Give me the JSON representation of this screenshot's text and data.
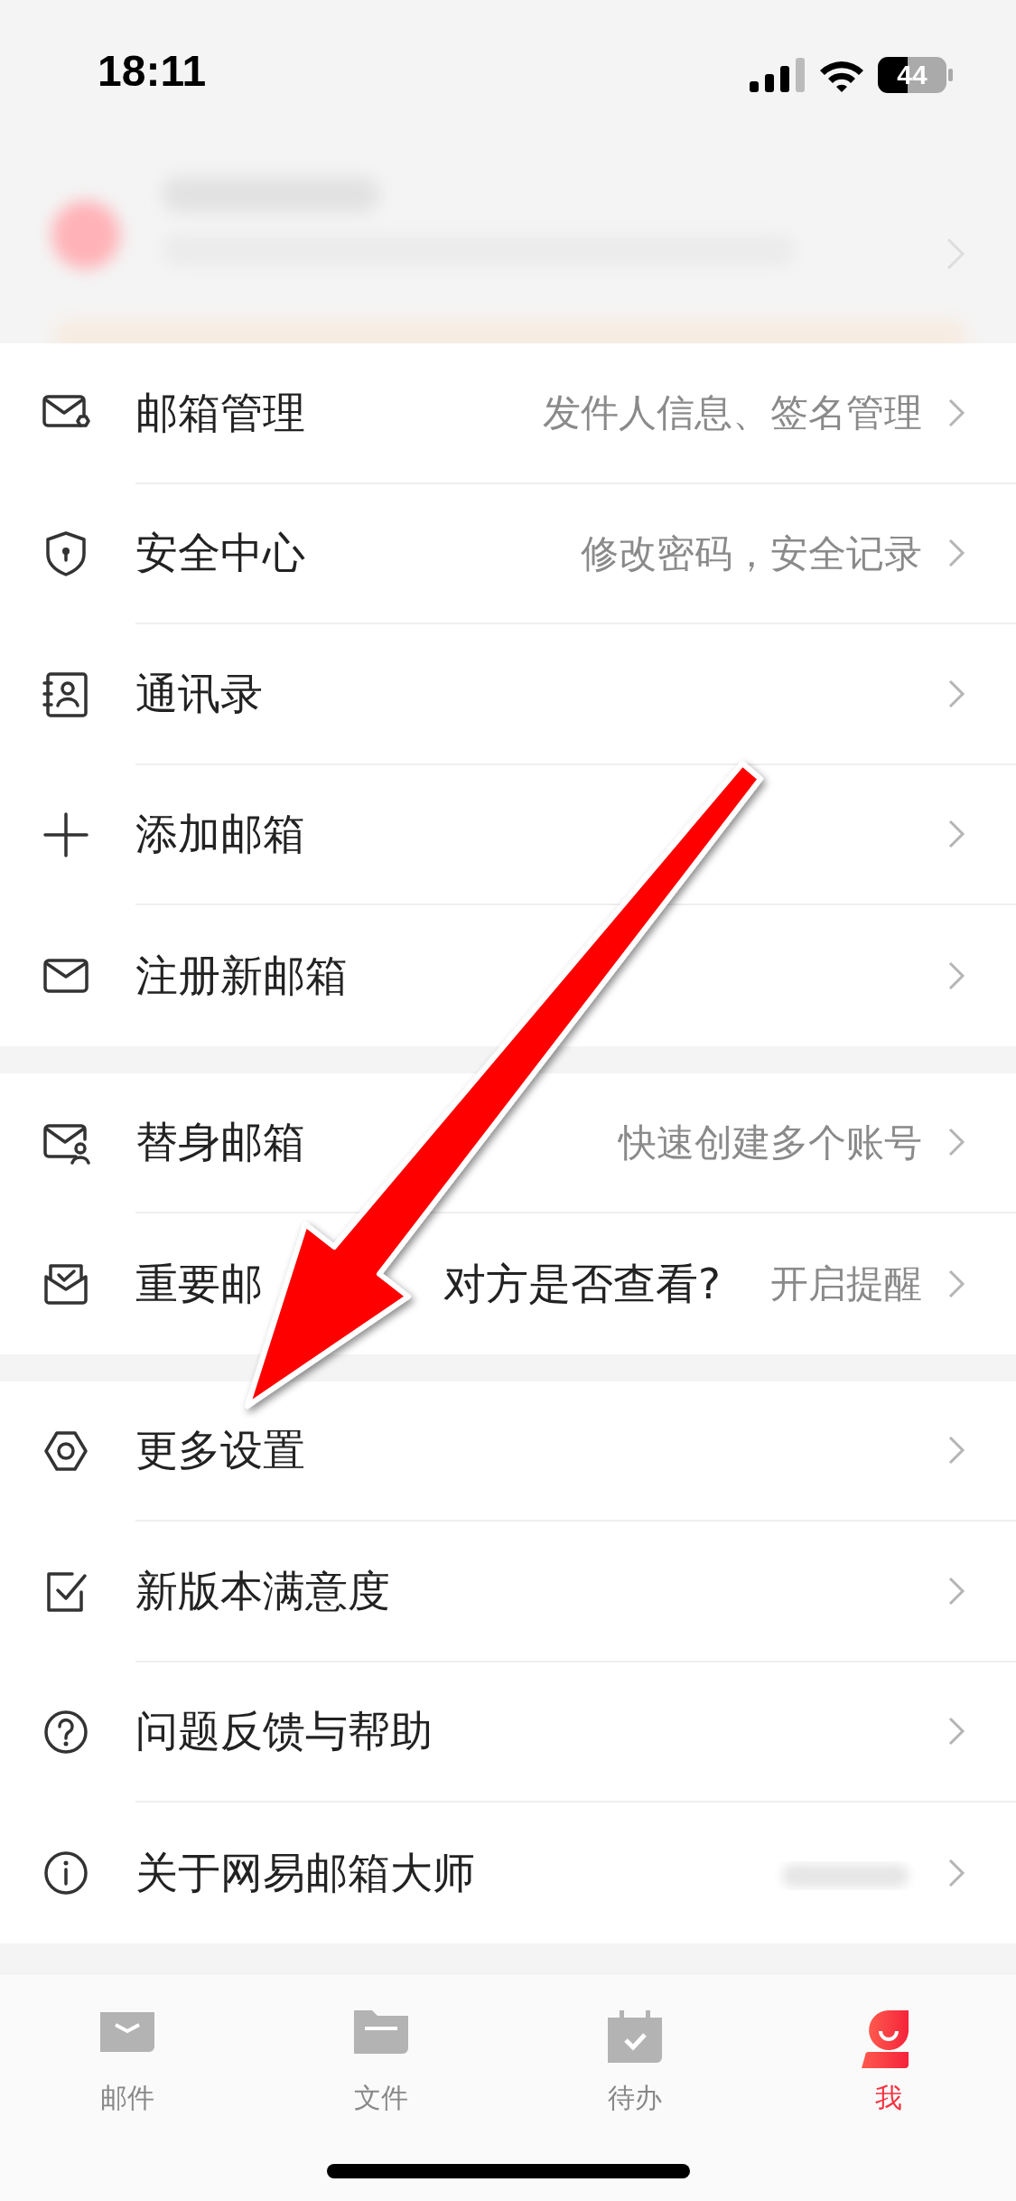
{
  "status_bar": {
    "time": "18:11",
    "battery": "44"
  },
  "sections": [
    {
      "items": [
        {
          "label": "邮箱管理",
          "detail": "发件人信息、签名管理"
        },
        {
          "label": "安全中心",
          "detail": "修改密码，安全记录"
        },
        {
          "label": "通讯录"
        },
        {
          "label": "添加邮箱"
        },
        {
          "label": "注册新邮箱"
        }
      ]
    },
    {
      "items": [
        {
          "label": "替身邮箱",
          "detail": "快速创建多个账号"
        },
        {
          "label_parts": [
            "重要邮",
            "对方是否查看?"
          ],
          "detail": "开启提醒"
        }
      ]
    },
    {
      "items": [
        {
          "label": "更多设置"
        },
        {
          "label": "新版本满意度"
        },
        {
          "label": "问题反馈与帮助"
        },
        {
          "label": "关于网易邮箱大师",
          "detail_blurred": true
        }
      ]
    }
  ],
  "tab_bar": [
    {
      "label": "邮件",
      "selected": false
    },
    {
      "label": "文件",
      "selected": false
    },
    {
      "label": "待办",
      "selected": false
    },
    {
      "label": "我",
      "selected": true
    }
  ]
}
